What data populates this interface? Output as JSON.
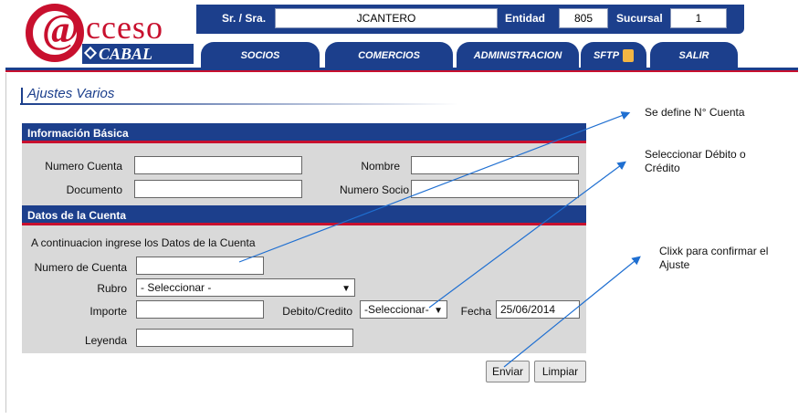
{
  "header": {
    "logo_word": "cceso",
    "logo_at": "@",
    "logo_sub": "CABAL",
    "user_label": "Sr. / Sra.",
    "user_value": "JCANTERO",
    "entity_label": "Entidad",
    "entity_value": "805",
    "branch_label": "Sucursal",
    "branch_value": "1"
  },
  "nav": {
    "items": [
      "SOCIOS",
      "COMERCIOS",
      "ADMINISTRACION",
      "SFTP",
      "SALIR"
    ]
  },
  "page": {
    "title": "Ajustes Varios"
  },
  "basic_info": {
    "header": "Información Básica",
    "account_number_label": "Numero Cuenta",
    "name_label": "Nombre",
    "document_label": "Documento",
    "member_number_label": "Numero Socio"
  },
  "account_data": {
    "header": "Datos de la Cuenta",
    "instruction": "A continuacion ingrese los Datos de la Cuenta",
    "account_number_label": "Numero de Cuenta",
    "category_label": "Rubro",
    "category_value": "- Seleccionar -",
    "amount_label": "Importe",
    "debit_credit_label": "Debito/Credito",
    "debit_credit_value": "-Seleccionar-",
    "date_label": "Fecha",
    "date_value": "25/06/2014",
    "legend_label": "Leyenda"
  },
  "buttons": {
    "send": "Enviar",
    "clear": "Limpiar"
  },
  "annotations": {
    "note1": "Se define N° Cuenta",
    "note2_line1": "Seleccionar Débito o",
    "note2_line2": "Crédito",
    "note3_line1": "Clixk para confirmar el",
    "note3_line2": "Ajuste"
  },
  "colors": {
    "brand_blue": "#1c3f8c",
    "brand_red": "#c8102e",
    "panel_gray": "#d9d9d9",
    "arrow": "#1f6fd1"
  }
}
